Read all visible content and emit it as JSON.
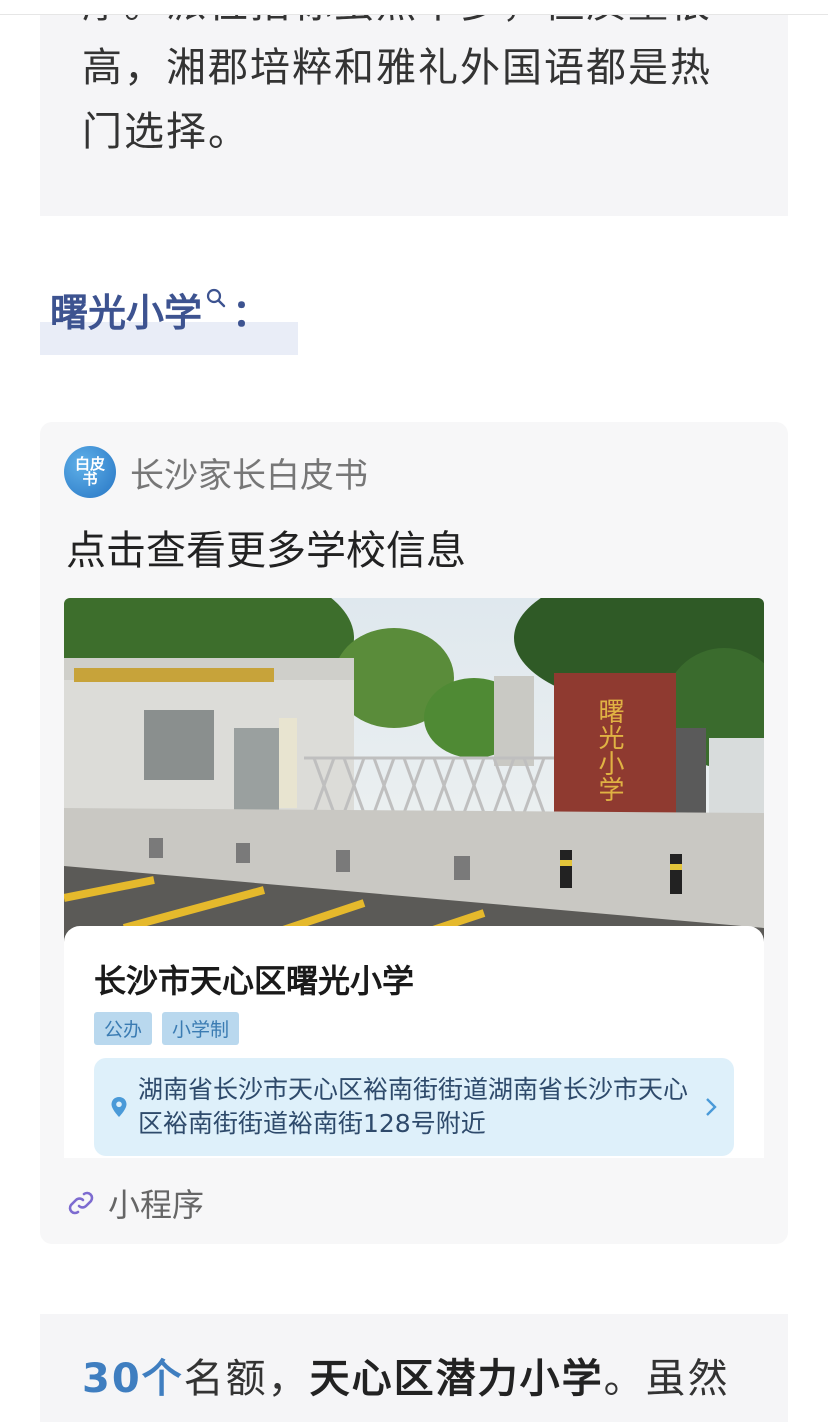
{
  "intro": {
    "text": "厚。派位指标虽然不多，但质量很高，湘郡培粹和雅礼外国语都是热门选择。"
  },
  "section": {
    "heading": "曙光小学",
    "colon": "："
  },
  "mini_program": {
    "account_name": "长沙家长白皮书",
    "avatar_text": "白皮书",
    "title": "点击查看更多学校信息",
    "school_name": "长沙市天心区曙光小学",
    "tags": [
      "公办",
      "小学制"
    ],
    "address": "湖南省长沙市天心区裕南街街道湖南省长沙市天心区裕南街街道裕南街128号附近",
    "footer_label": "小程序",
    "photo_sign_text": "曙光小学"
  },
  "next": {
    "number": "30个",
    "text1": "名额，",
    "school": "天心区潜力小学",
    "text2": "。虽然"
  },
  "colors": {
    "accent": "#3d5390",
    "link": "#3f7ec0",
    "tag_bg": "#b9d8ee",
    "address_bg": "#def0fa"
  }
}
